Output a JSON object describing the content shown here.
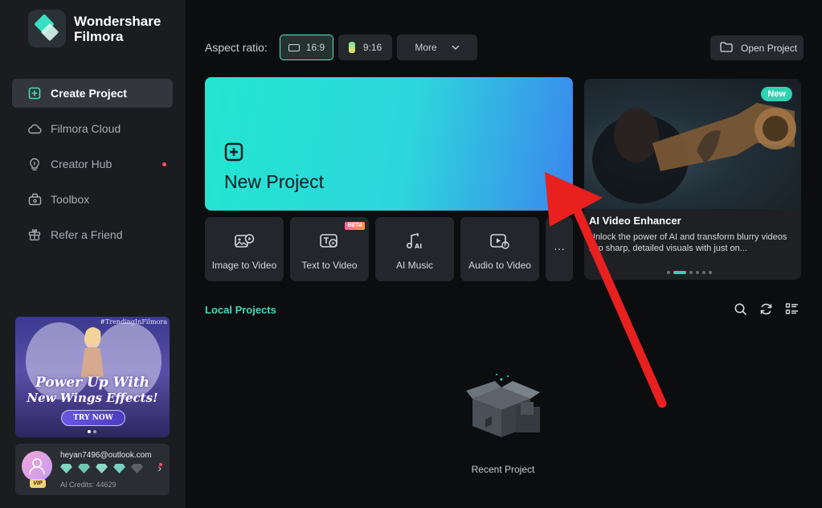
{
  "app": {
    "name": "Wondershare Filmora",
    "brand_line1": "Wondershare",
    "brand_line2": "Filmora"
  },
  "sidebar": {
    "items": [
      {
        "label": "Create Project",
        "icon": "plus-square-icon",
        "active": true
      },
      {
        "label": "Filmora Cloud",
        "icon": "cloud-icon"
      },
      {
        "label": "Creator Hub",
        "icon": "bulb-icon",
        "notification": true
      },
      {
        "label": "Toolbox",
        "icon": "toolbox-icon"
      },
      {
        "label": "Refer a Friend",
        "icon": "gift-icon"
      }
    ]
  },
  "promo": {
    "tag": "#TrendingInFilmora",
    "line1": "Power Up With",
    "line2": "New Wings Effects!",
    "button": "TRY NOW"
  },
  "user": {
    "email": "heyan7496@outlook.com",
    "badge": "VIP",
    "credits": "AI Credits: 44629"
  },
  "toolbar": {
    "aspect_label": "Aspect ratio:",
    "ratio_169": "16:9",
    "ratio_916": "9:16",
    "more": "More",
    "open_project": "Open Project"
  },
  "new_project": {
    "label": "New Project"
  },
  "tools": [
    {
      "label": "Image to Video",
      "icon": "image-to-video-icon"
    },
    {
      "label": "Text to Video",
      "icon": "text-to-video-icon",
      "badge": "BETA"
    },
    {
      "label": "AI Music",
      "icon": "ai-music-icon"
    },
    {
      "label": "Audio to Video",
      "icon": "audio-to-video-icon"
    }
  ],
  "tools_more": "···",
  "feature": {
    "badge": "New",
    "title": "AI Video Enhancer",
    "description": "Unlock the power of AI and transform blurry videos into sharp, detailed visuals with just on..."
  },
  "local": {
    "title": "Local Projects",
    "empty_label": "Recent Project"
  },
  "colors": {
    "accent": "#43d9b8",
    "new_project_gradient_start": "#22e6d0",
    "new_project_gradient_end": "#3b86ee",
    "annotation_arrow": "#e8201e"
  }
}
